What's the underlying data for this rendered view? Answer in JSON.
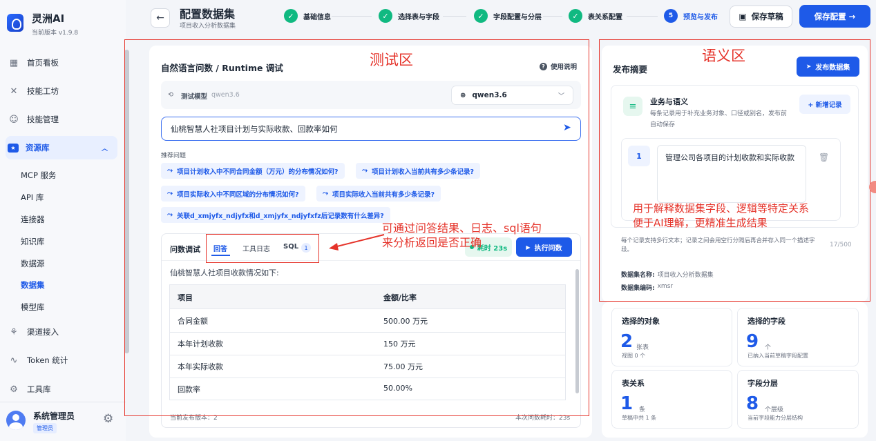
{
  "app": {
    "name": "灵洲AI",
    "version": "当前版本 v1.9.8"
  },
  "sidebar": {
    "items": [
      {
        "label": "首页看板",
        "icon": "dashboard-icon"
      },
      {
        "label": "技能工坊",
        "icon": "tools-icon"
      },
      {
        "label": "技能管理",
        "icon": "robot-icon"
      },
      {
        "label": "资源库",
        "icon": "folder-star-icon"
      },
      {
        "label": "渠道接入",
        "icon": "network-icon"
      },
      {
        "label": "Token 统计",
        "icon": "chart-line-icon"
      },
      {
        "label": "工具库",
        "icon": "toolbox-icon"
      }
    ],
    "sub_items": [
      "MCP 服务",
      "API 库",
      "连接器",
      "知识库",
      "数据源",
      "数据集",
      "模型库"
    ],
    "user": {
      "name": "系统管理员",
      "role": "管理员"
    }
  },
  "header": {
    "title": "配置数据集",
    "subtitle": "项目收入分析数据集",
    "steps": [
      {
        "label": "基础信息",
        "state": "done"
      },
      {
        "label": "选择表与字段",
        "state": "done"
      },
      {
        "label": "字段配置与分层",
        "state": "done"
      },
      {
        "label": "表关系配置",
        "state": "done"
      },
      {
        "label": "预览与发布",
        "state": "current",
        "num": "5"
      }
    ],
    "save_draft": "保存草稿",
    "save_config": "保存配置 →"
  },
  "test": {
    "title": "自然语言问数 / Runtime 调试",
    "help": "使用说明",
    "model_label": "测试模型",
    "model_hint": "qwen3.6",
    "model_value": "qwen3.6",
    "query": "仙桃智慧人社项目计划与实际收款、回款率如何",
    "rec_title": "推荐问题",
    "recs": [
      "项目计划收入中不同合同金额（万元）的分布情况如何?",
      "项目计划收入当前共有多少条记录?",
      "项目实际收入中不同区域的分布情况如何?",
      "项目实际收入当前共有多少条记录?",
      "关联d_xmjyfx_ndjyfx和d_xmjyfx_ndjyfxfz后记录数有什么差异?"
    ],
    "debug_title": "问数调试",
    "tabs": [
      {
        "label": "回答"
      },
      {
        "label": "工具日志"
      },
      {
        "label": "SQL",
        "badge": "1"
      }
    ],
    "time_badge": "耗时 23s",
    "run": "执行问数",
    "answer_intro": "仙桃智慧人社项目收款情况如下:",
    "table": {
      "headers": [
        "项目",
        "金额/比率"
      ],
      "rows": [
        [
          "合同金额",
          "500.00 万元"
        ],
        [
          "本年计划收款",
          "150 万元"
        ],
        [
          "本年实际收款",
          "75.00 万元"
        ],
        [
          "回款率",
          "50.00%"
        ]
      ]
    },
    "footer_left": "当前发布版本：2",
    "footer_right": "本次问数耗时：23s"
  },
  "publish": {
    "title": "发布摘要",
    "button": "发布数据集",
    "biz": {
      "title": "业务与语义",
      "desc": "每条记录用于补充业务对象、口径或别名，发布前自动保存",
      "add": "+ 新增记录",
      "record_index": "1",
      "record_text": "管理公司各项目的计划收款和实际收款",
      "note": "每个记录支持多行文本；记录之间会用空行分隔后再合并存入同一个描述字段。",
      "count": "17/500"
    },
    "meta": [
      {
        "k": "数据集名称:",
        "v": "项目收入分析数据集"
      },
      {
        "k": "数据集编码:",
        "v": "xmsr"
      }
    ]
  },
  "stats": [
    {
      "title": "选择的对象",
      "num": "2",
      "unit": "张表",
      "sub": "视图 0 个"
    },
    {
      "title": "选择的字段",
      "num": "9",
      "unit": "个",
      "sub": "已纳入当前草稿字段配置"
    },
    {
      "title": "表关系",
      "num": "1",
      "unit": "条",
      "sub": "草稿中共 1 条"
    },
    {
      "title": "字段分层",
      "num": "8",
      "unit": "个层级",
      "sub": "当前字段能力分层结构"
    }
  ],
  "annotations": {
    "test_zone": "测试区",
    "semantic_zone": "语义区",
    "arrow_note": [
      "可通过问答结果、日志、sql语句",
      "来分析返回是否正确"
    ],
    "semantic_note": [
      "用于解释数据集字段、逻辑等特定关系",
      "便于AI理解，更精准生成结果"
    ]
  },
  "colors": {
    "primary": "#1e5ae8",
    "success": "#10b981",
    "annotation": "#e5332a"
  }
}
